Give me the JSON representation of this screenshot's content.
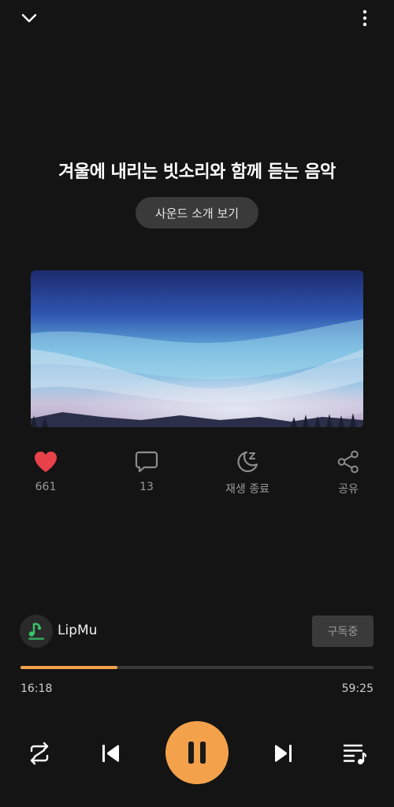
{
  "header": {
    "collapse_icon": "chevron-down-icon",
    "more_icon": "more-vertical-icon"
  },
  "track": {
    "title": "겨울에 내리는 빗소리와 함께 듣는 음악",
    "intro_button_label": "사운드 소개 보기"
  },
  "actions": {
    "like": {
      "icon": "heart-icon",
      "label": "661",
      "color": "#e8414a"
    },
    "comment": {
      "icon": "comment-icon",
      "label": "13"
    },
    "sleep_timer": {
      "icon": "moon-sleep-icon",
      "label": "재생 종료"
    },
    "share": {
      "icon": "share-icon",
      "label": "공유"
    }
  },
  "channel": {
    "name": "LipMu",
    "subscribe_label": "구독중"
  },
  "playback": {
    "current_time": "16:18",
    "total_time": "59:25",
    "progress_fraction": 0.274,
    "accent_color": "#f3a24b"
  },
  "controls": {
    "repeat_icon": "repeat-icon",
    "prev_icon": "skip-previous-icon",
    "play_pause_icon": "pause-icon",
    "next_icon": "skip-next-icon",
    "playlist_icon": "playlist-icon"
  }
}
